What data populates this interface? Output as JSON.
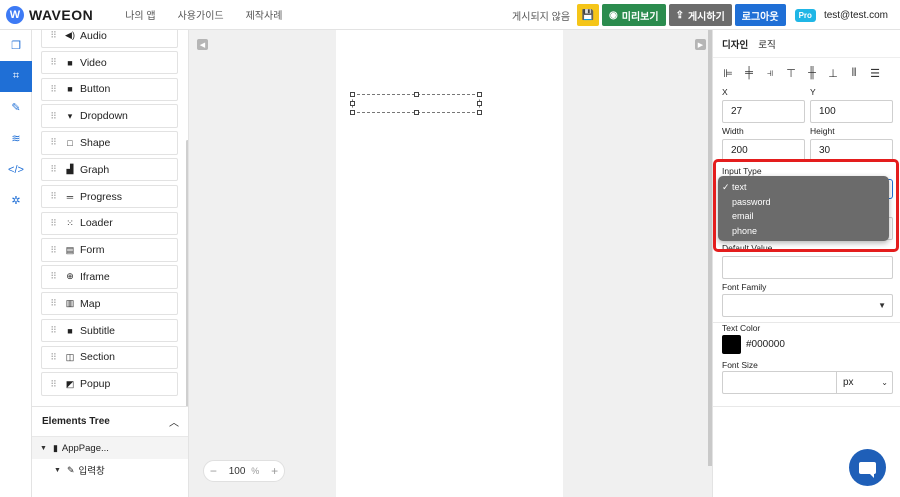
{
  "topbar": {
    "logo_letter": "W",
    "logo_text": "WAVEON",
    "nav": [
      "나의 앱",
      "사용가이드",
      "제작사례"
    ],
    "status": "게시되지 않음",
    "preview_label": "미리보기",
    "publish_label": "게시하기",
    "logout_label": "로그아웃",
    "badge": "Pro",
    "email": "test@test.com"
  },
  "components": [
    {
      "icon": "◀)",
      "label": "Audio"
    },
    {
      "icon": "■",
      "label": "Video"
    },
    {
      "icon": "■",
      "label": "Button"
    },
    {
      "icon": "▾",
      "label": "Dropdown"
    },
    {
      "icon": "□",
      "label": "Shape"
    },
    {
      "icon": "▟",
      "label": "Graph"
    },
    {
      "icon": "═",
      "label": "Progress"
    },
    {
      "icon": "⁙",
      "label": "Loader"
    },
    {
      "icon": "▤",
      "label": "Form"
    },
    {
      "icon": "⊕",
      "label": "Iframe"
    },
    {
      "icon": "▥",
      "label": "Map"
    },
    {
      "icon": "■",
      "label": "Subtitle"
    },
    {
      "icon": "◫",
      "label": "Section"
    },
    {
      "icon": "◩",
      "label": "Popup"
    }
  ],
  "tree": {
    "title": "Elements Tree",
    "root": "AppPage...",
    "child": "입력창"
  },
  "canvas": {
    "zoom_value": "100",
    "zoom_unit": "%"
  },
  "props": {
    "tabs": [
      "디자인",
      "로직"
    ],
    "x_label": "X",
    "x_value": "27",
    "y_label": "Y",
    "y_value": "100",
    "width_label": "Width",
    "width_value": "200",
    "height_label": "Height",
    "height_value": "30",
    "input_type_label": "Input Type",
    "default_value_label": "Default Value",
    "font_family_label": "Font Family",
    "text_color_label": "Text Color",
    "text_color_value": "#000000",
    "font_size_label": "Font Size",
    "font_size_unit": "px"
  },
  "input_type_options": [
    "text",
    "password",
    "email",
    "phone"
  ],
  "selected_option": "text",
  "colors": {
    "accent": "#1f6fd6",
    "preview": "#2b8c4e",
    "save": "#f5c518",
    "highlight": "#e41d1d"
  }
}
